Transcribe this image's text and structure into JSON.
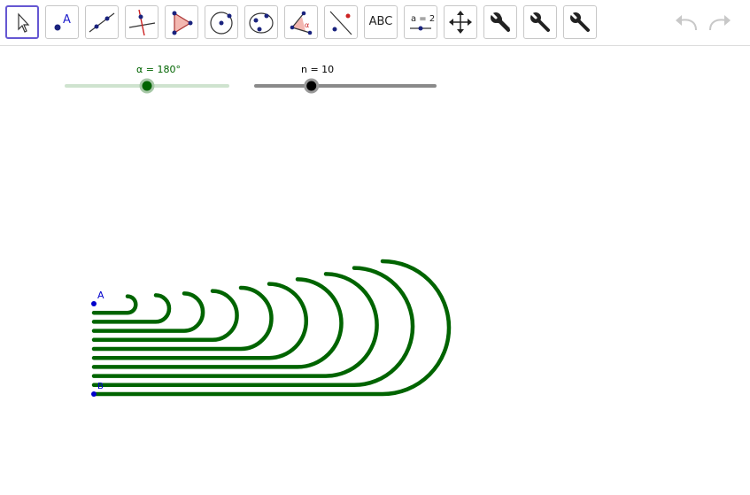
{
  "toolbar": {
    "tools": [
      {
        "name": "move",
        "label": ""
      },
      {
        "name": "point",
        "label": "A"
      },
      {
        "name": "line",
        "label": ""
      },
      {
        "name": "perpendicular-line",
        "label": ""
      },
      {
        "name": "polygon",
        "label": ""
      },
      {
        "name": "circle",
        "label": ""
      },
      {
        "name": "conic",
        "label": ""
      },
      {
        "name": "angle",
        "label": ""
      },
      {
        "name": "reflect",
        "label": ""
      },
      {
        "name": "text",
        "label": "ABC"
      },
      {
        "name": "slider",
        "label": "a = 2"
      },
      {
        "name": "move-view",
        "label": ""
      },
      {
        "name": "custom-tool-1",
        "label": ""
      },
      {
        "name": "custom-tool-2",
        "label": ""
      },
      {
        "name": "custom-tool-3",
        "label": ""
      }
    ],
    "undo_icon": "undo-icon",
    "redo_icon": "redo-icon"
  },
  "sliders": {
    "alpha": {
      "label": "α = 180°",
      "value": 180,
      "min": 0,
      "max": 360,
      "color": "#006400"
    },
    "n": {
      "label": "n = 10",
      "value": 10,
      "min": 1,
      "max": 30,
      "color": "#000000"
    }
  },
  "points": {
    "A": {
      "label": "A",
      "color": "#0000cc"
    },
    "B": {
      "label": "B",
      "color": "#0000cc"
    }
  },
  "construction": {
    "color": "#006400",
    "count": 10,
    "angle_deg": 180
  }
}
